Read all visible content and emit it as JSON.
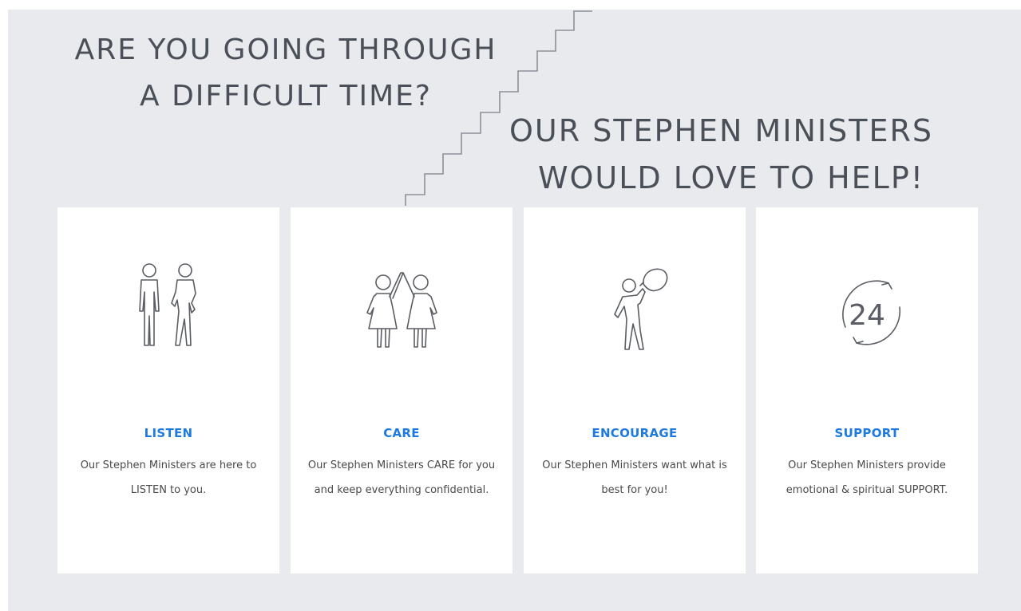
{
  "headline_left": {
    "line1": "ARE YOU GOING THROUGH",
    "line2": "A DIFFICULT TIME?"
  },
  "headline_right": {
    "line1": "OUR STEPHEN MINISTERS",
    "line2": "WOULD LOVE TO HELP!"
  },
  "colors": {
    "background": "#e9eaee",
    "card": "#ffffff",
    "headline": "#4b5058",
    "title_accent": "#1f7ae0",
    "body_text": "#4a4a4a"
  },
  "cards": [
    {
      "icon": "two-people-standing-icon",
      "title": "LISTEN",
      "text": "Our Stephen Ministers are here to LISTEN to you."
    },
    {
      "icon": "two-people-high-five-icon",
      "title": "CARE",
      "text": "Our Stephen Ministers CARE for you and keep everything confidential."
    },
    {
      "icon": "person-carrying-sack-icon",
      "title": "ENCOURAGE",
      "text": "Our Stephen Ministers want what is best for you!"
    },
    {
      "icon": "24-hours-cycle-icon",
      "title": "SUPPORT",
      "text": "Our Stephen Ministers provide emotional & spiritual SUPPORT."
    }
  ],
  "icon_text": {
    "hours": "24"
  }
}
